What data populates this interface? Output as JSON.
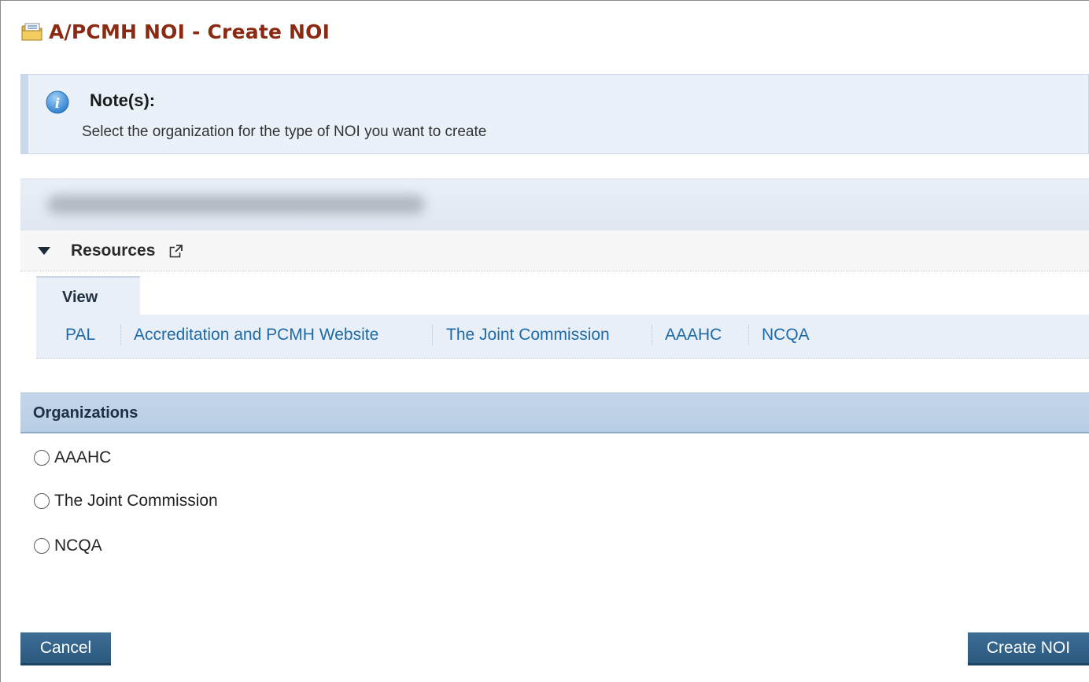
{
  "page": {
    "title": "A/PCMH NOI - Create NOI"
  },
  "note": {
    "heading": "Note(s):",
    "text": "Select the organization for the type of NOI you want to create"
  },
  "resources": {
    "label": "Resources",
    "tab_label": "View",
    "links": [
      "PAL",
      "Accreditation and PCMH Website",
      "The Joint Commission",
      "AAAHC",
      "NCQA"
    ]
  },
  "organizations": {
    "header": "Organizations",
    "options": [
      "AAAHC",
      "The Joint Commission",
      "NCQA"
    ],
    "selected": null
  },
  "actions": {
    "cancel_label": "Cancel",
    "create_label": "Create NOI"
  },
  "colors": {
    "title": "#8b2a12",
    "link": "#1e6aa8",
    "button": "#2b587d",
    "note_bg": "#eaf1f9",
    "header_bg": "#b8cde4"
  }
}
